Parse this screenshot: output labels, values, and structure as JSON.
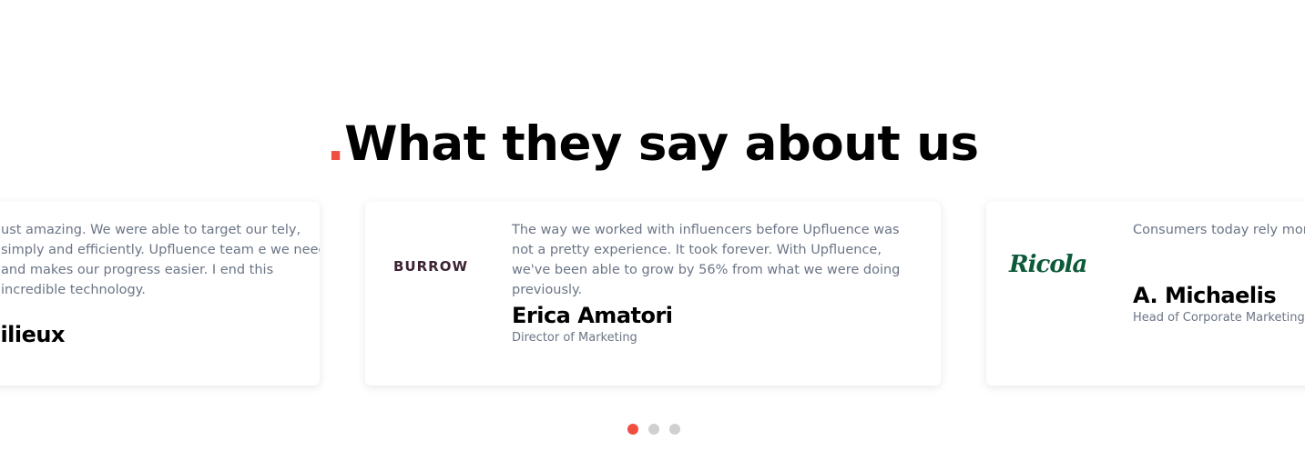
{
  "section": {
    "heading_dot": ".",
    "heading_text": "What they say about us"
  },
  "testimonials": [
    {
      "quote": "ust amazing. We were able to target our tely, simply and efficiently. Upfluence team e we need and makes our progress easier. I end this incredible technology.",
      "name": "llilieux",
      "role": ""
    },
    {
      "logo": "BURROW",
      "quote": "The way we worked with influencers before Upfluence was not a pretty experience. It took forever. With Upfluence, we've been able to grow by 56% from what we were doing previously.",
      "name": "Erica Amatori",
      "role": "Director of Marketing"
    },
    {
      "logo": "Ricola",
      "quote": "Consumers today rely more they place their trust",
      "name": "A. Michaelis",
      "role": "Head of Corporate Marketing"
    }
  ],
  "pagination": {
    "active_index": 0,
    "count": 3,
    "colors": {
      "active": "#f04e3e",
      "inactive": "#d0d0d0"
    }
  }
}
